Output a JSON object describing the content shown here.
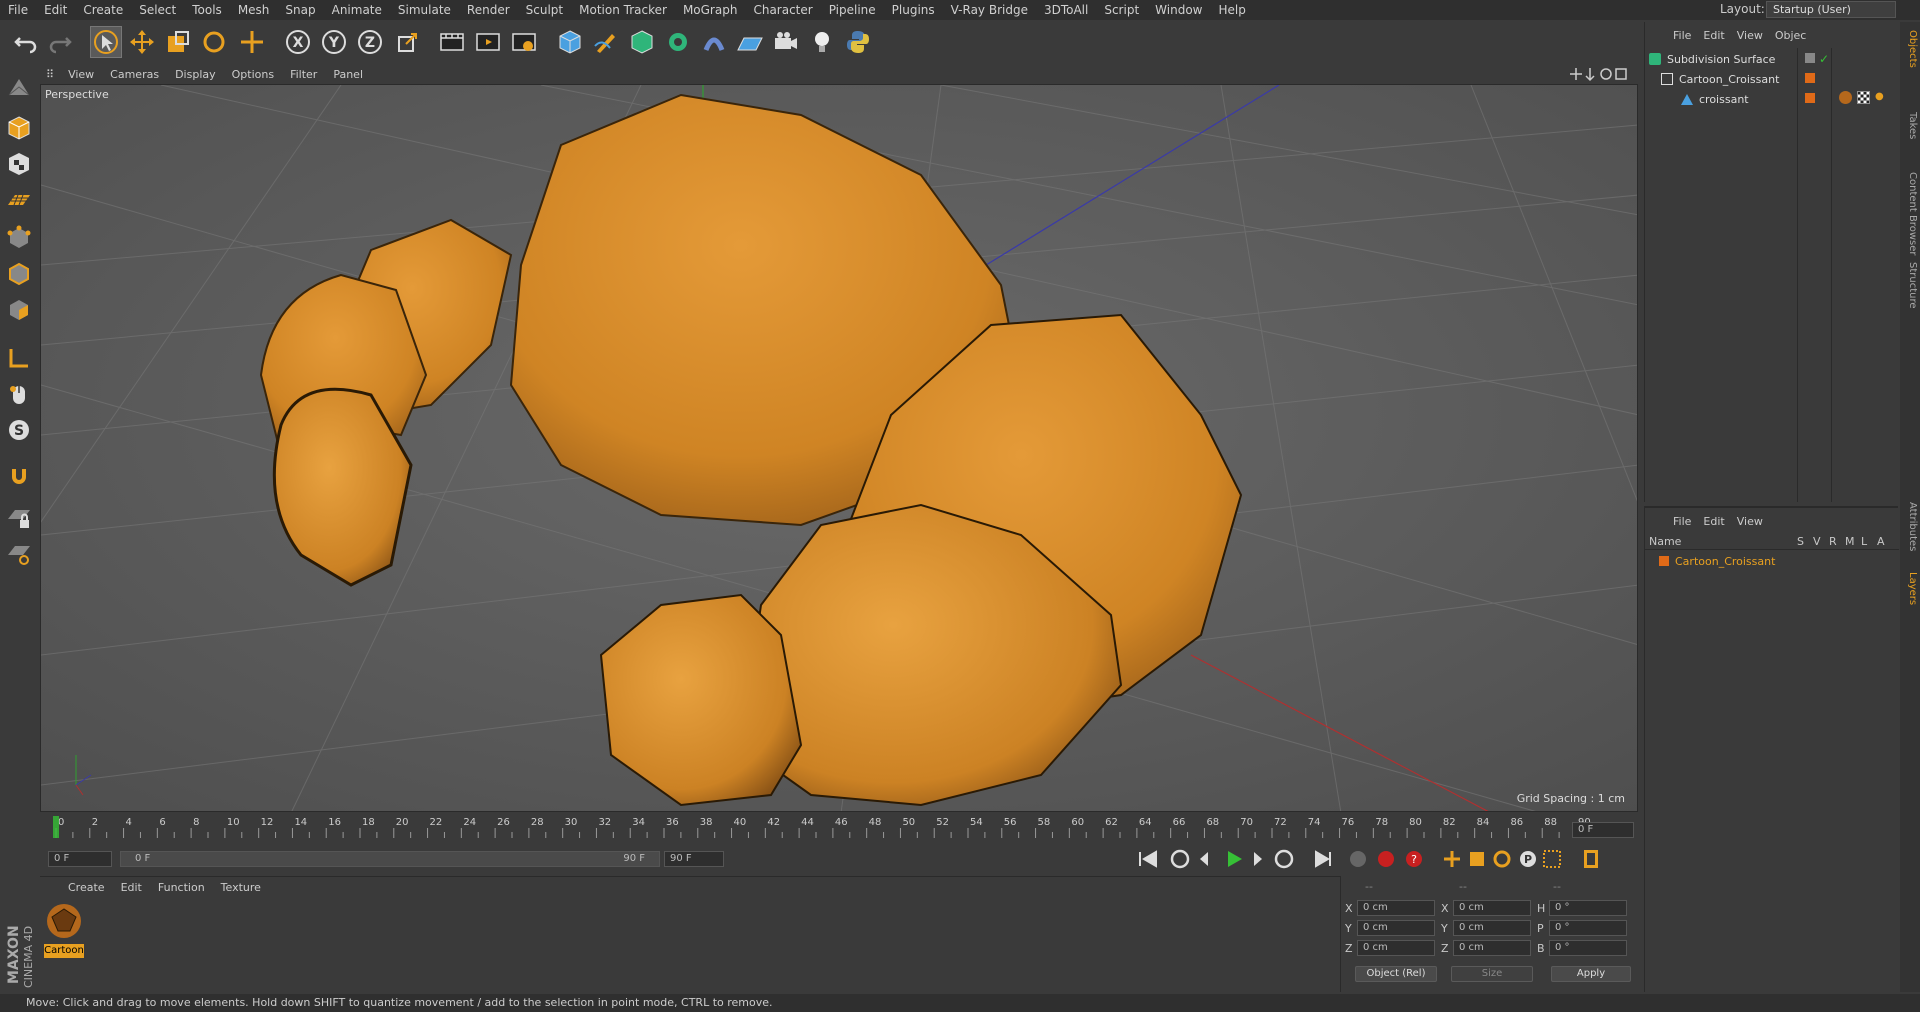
{
  "menubar": {
    "items": [
      "File",
      "Edit",
      "Create",
      "Select",
      "Tools",
      "Mesh",
      "Snap",
      "Animate",
      "Simulate",
      "Render",
      "Sculpt",
      "Motion Tracker",
      "MoGraph",
      "Character",
      "Pipeline",
      "Plugins",
      "V-Ray Bridge",
      "3DToAll",
      "Script",
      "Window",
      "Help"
    ],
    "layout_label": "Layout:",
    "layout_value": "Startup (User)"
  },
  "viewport": {
    "menu": [
      "View",
      "Cameras",
      "Display",
      "Options",
      "Filter",
      "Panel"
    ],
    "label": "Perspective",
    "grid_spacing": "Grid Spacing : 1 cm"
  },
  "timeline": {
    "ticks": [
      "0",
      "2",
      "4",
      "6",
      "8",
      "10",
      "12",
      "14",
      "16",
      "18",
      "20",
      "22",
      "24",
      "26",
      "28",
      "30",
      "32",
      "34",
      "36",
      "38",
      "40",
      "42",
      "44",
      "46",
      "48",
      "50",
      "52",
      "54",
      "56",
      "58",
      "60",
      "62",
      "64",
      "66",
      "68",
      "70",
      "72",
      "74",
      "76",
      "78",
      "80",
      "82",
      "84",
      "86",
      "88",
      "90"
    ],
    "current_frame": "0 F",
    "start_field": "0 F",
    "range_start": "0 F",
    "range_end": "90 F",
    "end_field": "90 F"
  },
  "material_panel": {
    "menu": [
      "Create",
      "Edit",
      "Function",
      "Texture"
    ],
    "material_name": "Cartoon"
  },
  "coords": {
    "header1": "--",
    "header2": "--",
    "header3": "--",
    "rows": [
      {
        "a_label": "X",
        "a_val": "0 cm",
        "b_label": "X",
        "b_val": "0 cm",
        "c_label": "H",
        "c_val": "0 °"
      },
      {
        "a_label": "Y",
        "a_val": "0 cm",
        "b_label": "Y",
        "b_val": "0 cm",
        "c_label": "P",
        "c_val": "0 °"
      },
      {
        "a_label": "Z",
        "a_val": "0 cm",
        "b_label": "Z",
        "b_val": "0 cm",
        "c_label": "B",
        "c_val": "0 °"
      }
    ],
    "mode": "Object (Rel)",
    "size": "Size",
    "apply": "Apply"
  },
  "objects_panel": {
    "menu": [
      "File",
      "Edit",
      "View",
      "Objec"
    ],
    "items": [
      {
        "name": "Subdivision Surface"
      },
      {
        "name": "Cartoon_Croissant"
      },
      {
        "name": "croissant"
      }
    ]
  },
  "layers_panel": {
    "menu": [
      "File",
      "Edit",
      "View"
    ],
    "col_name": "Name",
    "cols": [
      "S",
      "V",
      "R",
      "M",
      "L",
      "A"
    ],
    "layer_name": "Cartoon_Croissant"
  },
  "right_tabs": [
    "Objects",
    "Takes",
    "Content Browser",
    "Structure",
    "Attributes",
    "Layers"
  ],
  "status": "Move: Click and drag to move elements. Hold down SHIFT to quantize movement / add to the selection in point mode, CTRL to remove.",
  "brand": [
    "MAXON",
    "CINEMA 4D"
  ],
  "colors": {
    "accent": "#e8a020",
    "croissant": "#d98e2c"
  }
}
